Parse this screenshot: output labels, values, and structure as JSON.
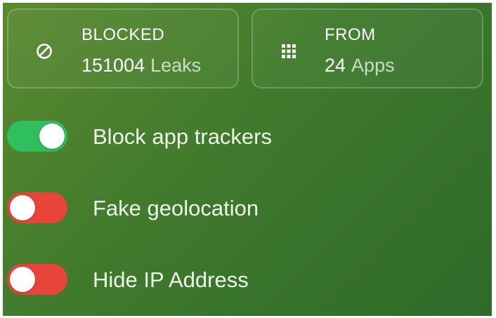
{
  "stats": {
    "blocked": {
      "title": "BLOCKED",
      "count": "151004",
      "unit": "Leaks",
      "icon": "block-icon"
    },
    "from": {
      "title": "FROM",
      "count": "24",
      "unit": "Apps",
      "icon": "apps-grid-icon"
    }
  },
  "toggles": [
    {
      "label": "Block app trackers",
      "state": "on",
      "color": "#2fbf5f"
    },
    {
      "label": "Fake geolocation",
      "state": "off",
      "color": "#e8443a"
    },
    {
      "label": "Hide IP Address",
      "state": "off",
      "color": "#e8443a"
    }
  ],
  "colors": {
    "background": "#3f7a2c",
    "toggle_on": "#2fbf5f",
    "toggle_off": "#e8443a"
  }
}
